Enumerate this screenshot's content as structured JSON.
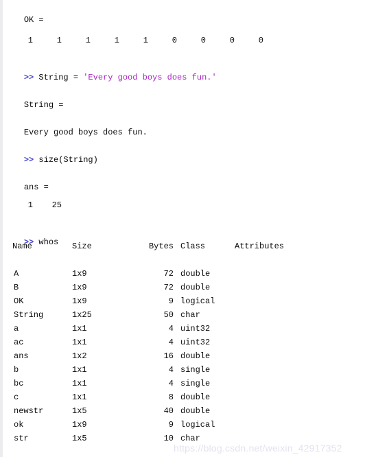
{
  "window": {
    "title": "MATLAB Command Window",
    "prompt_symbol": ">>",
    "background_color": "#ffffff",
    "text_color": "#0a0a0a",
    "prompt_color": "#4a46cf",
    "string_literal_color": "#a927c4",
    "gutter_color": "#ececee",
    "watermark_color": "#e3e3ef"
  },
  "watermark": {
    "text": "https://blog.csdn.net/weixin_42917352"
  },
  "output": {
    "ok_label": "OK =",
    "ok_values": [
      "1",
      "1",
      "1",
      "1",
      "1",
      "0",
      "0",
      "0",
      "0"
    ],
    "cmd_string_assign_name": "String = ",
    "cmd_string_assign_literal": "'Every good boys does fun.'",
    "string_label": "String =",
    "string_value": "Every good boys does fun.",
    "cmd_size": "size(String)",
    "ans_label": "ans =",
    "ans_values": [
      "1",
      "25"
    ],
    "cmd_whos": "whos"
  },
  "whos_table": {
    "headers": {
      "name": "Name",
      "size": "Size",
      "bytes": "Bytes",
      "class": "Class",
      "attributes": "Attributes"
    },
    "rows": [
      {
        "name": "A",
        "size": "1x9",
        "bytes": "72",
        "class": "double",
        "attributes": ""
      },
      {
        "name": "B",
        "size": "1x9",
        "bytes": "72",
        "class": "double",
        "attributes": ""
      },
      {
        "name": "OK",
        "size": "1x9",
        "bytes": "9",
        "class": "logical",
        "attributes": ""
      },
      {
        "name": "String",
        "size": "1x25",
        "bytes": "50",
        "class": "char",
        "attributes": ""
      },
      {
        "name": "a",
        "size": "1x1",
        "bytes": "4",
        "class": "uint32",
        "attributes": ""
      },
      {
        "name": "ac",
        "size": "1x1",
        "bytes": "4",
        "class": "uint32",
        "attributes": ""
      },
      {
        "name": "ans",
        "size": "1x2",
        "bytes": "16",
        "class": "double",
        "attributes": ""
      },
      {
        "name": "b",
        "size": "1x1",
        "bytes": "4",
        "class": "single",
        "attributes": ""
      },
      {
        "name": "bc",
        "size": "1x1",
        "bytes": "4",
        "class": "single",
        "attributes": ""
      },
      {
        "name": "c",
        "size": "1x1",
        "bytes": "8",
        "class": "double",
        "attributes": ""
      },
      {
        "name": "newstr",
        "size": "1x5",
        "bytes": "40",
        "class": "double",
        "attributes": ""
      },
      {
        "name": "ok",
        "size": "1x9",
        "bytes": "9",
        "class": "logical",
        "attributes": ""
      },
      {
        "name": "str",
        "size": "1x5",
        "bytes": "10",
        "class": "char",
        "attributes": ""
      }
    ]
  }
}
